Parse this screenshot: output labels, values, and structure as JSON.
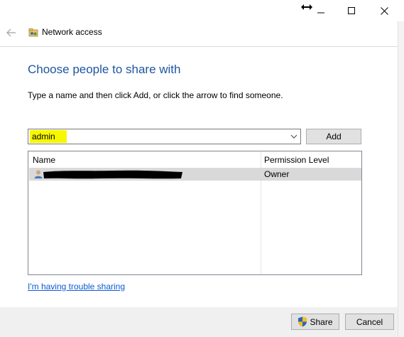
{
  "window": {
    "title": "Network access",
    "controls": {
      "minimize_icon": "minimize-icon",
      "maximize_icon": "maximize-icon",
      "close_icon": "close-icon"
    }
  },
  "page": {
    "heading": "Choose people to share with",
    "instructions": "Type a name and then click Add, or click the arrow to find someone."
  },
  "name_input": {
    "value": "admin",
    "highlight_color": "#f7f700"
  },
  "add_button": {
    "label": "Add"
  },
  "list": {
    "columns": [
      "Name",
      "Permission Level"
    ],
    "rows": [
      {
        "name": "",
        "permission": "Owner",
        "redacted": true,
        "icon": "user-icon"
      }
    ]
  },
  "trouble_link": "I'm having trouble sharing",
  "footer": {
    "share_label": "Share",
    "cancel_label": "Cancel"
  },
  "colors": {
    "heading": "#1e56a0",
    "link": "#0b5bd3",
    "selected_row": "#d9d9d9"
  }
}
